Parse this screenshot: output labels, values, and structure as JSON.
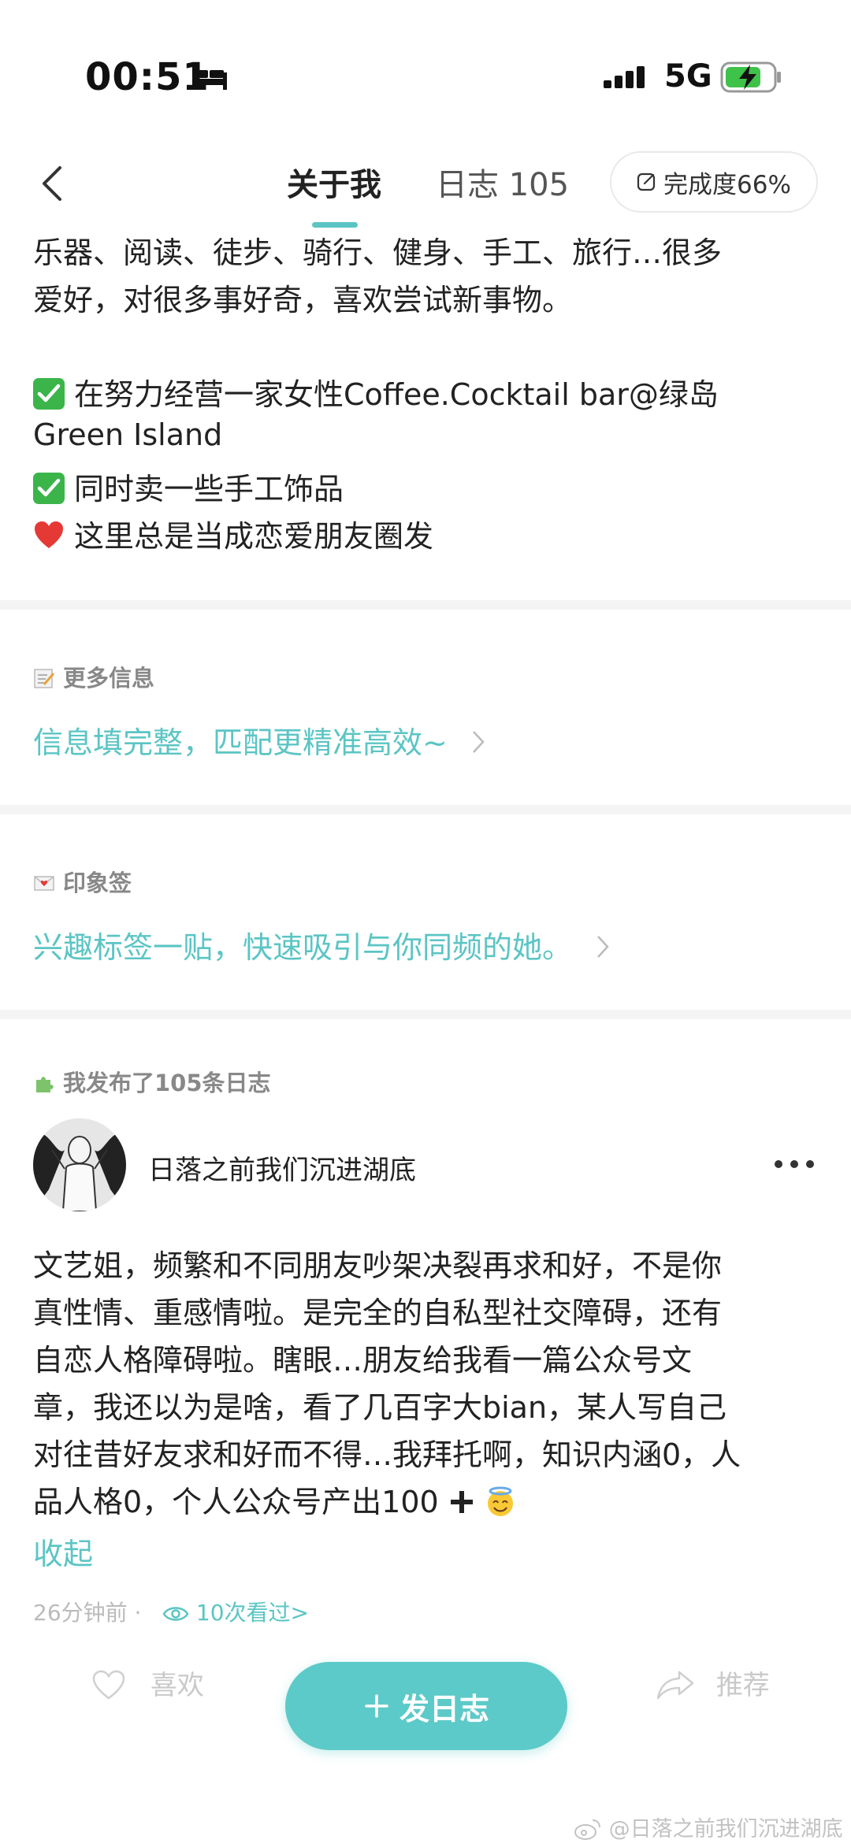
{
  "status_bar": {
    "time": "00:51",
    "network": "5G",
    "icons": [
      "bed-icon",
      "signal-icon",
      "battery-charging-icon"
    ]
  },
  "nav": {
    "tabs": [
      {
        "label": "关于我"
      },
      {
        "label": "日志 105"
      }
    ],
    "completion": "完成度66%"
  },
  "bio": {
    "lines": [
      "乐器、阅读、徒步、骑行、健身、手工、旅行…很多",
      "爱好，对很多事好奇，喜欢尝试新事物。"
    ],
    "items": [
      "在努力经营一家女性Coffee.Cocktail bar@绿岛",
      "Green Island",
      "同时卖一些手工饰品",
      "这里总是当成恋爱朋友圈发"
    ]
  },
  "more_info": {
    "title": "更多信息",
    "link": "信息填完整，匹配更精准高效~"
  },
  "impression": {
    "title": "印象签",
    "link": "兴趣标签一贴，快速吸引与你同频的她。"
  },
  "posts_section": {
    "title": "我发布了105条日志",
    "post": {
      "author": "日落之前我们沉进湖底",
      "lines": [
        "文艺姐，频繁和不同朋友吵架决裂再求和好，不是你",
        "真性情、重感情啦。是完全的自私型社交障碍，还有",
        "自恋人格障碍啦。瞎眼…朋友给我看一篇公众号文",
        "章，我还以为是啥，看了几百字大bian，某人写自己",
        "对往昔好友求和好而不得…我拜托啊，知识内涵0，人",
        "品人格0，个人公众号产出100"
      ],
      "collapse": "收起",
      "time": "26分钟前 ·",
      "views": "10次看过>",
      "like": "喜欢",
      "recommend": "推荐"
    }
  },
  "fab": {
    "label": "发日志"
  },
  "watermark": "@日落之前我们沉进湖底",
  "colors": {
    "accent": "#5bc5c4",
    "check": "#3bb54a",
    "heart": "#e53935"
  }
}
